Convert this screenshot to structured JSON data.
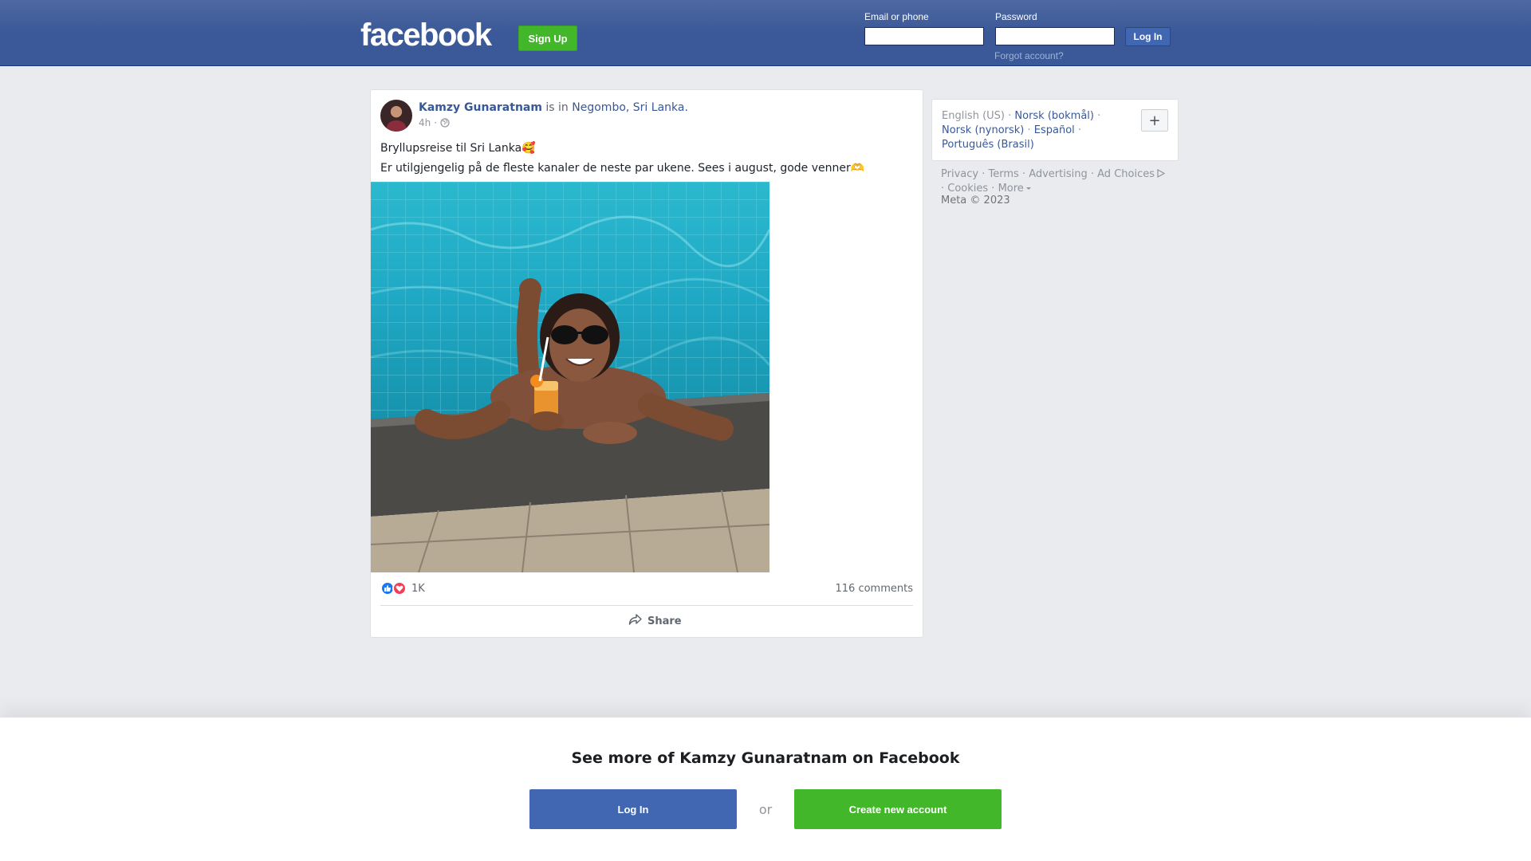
{
  "header": {
    "logo_text": "facebook",
    "signup_label": "Sign Up",
    "email_label": "Email or phone",
    "email_value": "",
    "password_label": "Password",
    "password_value": "",
    "login_label": "Log In",
    "forgot_label": "Forgot account?"
  },
  "post": {
    "author": "Kamzy Gunaratnam",
    "is_in": "is in",
    "location": "Negombo, Sri Lanka.",
    "time": "4h",
    "separator": "·",
    "privacy_icon": "globe-icon",
    "text_line1": "Bryllupsreise til Sri Lanka🥰",
    "text_line2": "Er utilgjengelig på de fleste kanaler de neste par ukene. Sees i august, gode venner🫶",
    "reaction_icons": [
      "like-icon",
      "love-icon"
    ],
    "reaction_count": "1K",
    "comments": "116 comments",
    "share_label": "Share"
  },
  "sidebar": {
    "languages": [
      {
        "label": "English (US)",
        "current": true
      },
      {
        "label": "Norsk (bokmål)",
        "current": false
      },
      {
        "label": "Norsk (nynorsk)",
        "current": false
      },
      {
        "label": "Español",
        "current": false
      },
      {
        "label": "Português (Brasil)",
        "current": false
      }
    ],
    "lang_separator": " · ",
    "add_language": "+",
    "footer_links": [
      "Privacy",
      "Terms",
      "Advertising",
      "Ad Choices",
      "Cookies",
      "More"
    ],
    "copyright": "Meta © 2023"
  },
  "banner": {
    "title": "See more of Kamzy Gunaratnam on Facebook",
    "login_label": "Log In",
    "or_label": "or",
    "create_label": "Create new account"
  },
  "colors": {
    "brand_blue": "#3b5998",
    "link_blue": "#385898",
    "button_blue": "#4267b2",
    "green": "#42b72a",
    "page_bg": "#e9ebee"
  }
}
